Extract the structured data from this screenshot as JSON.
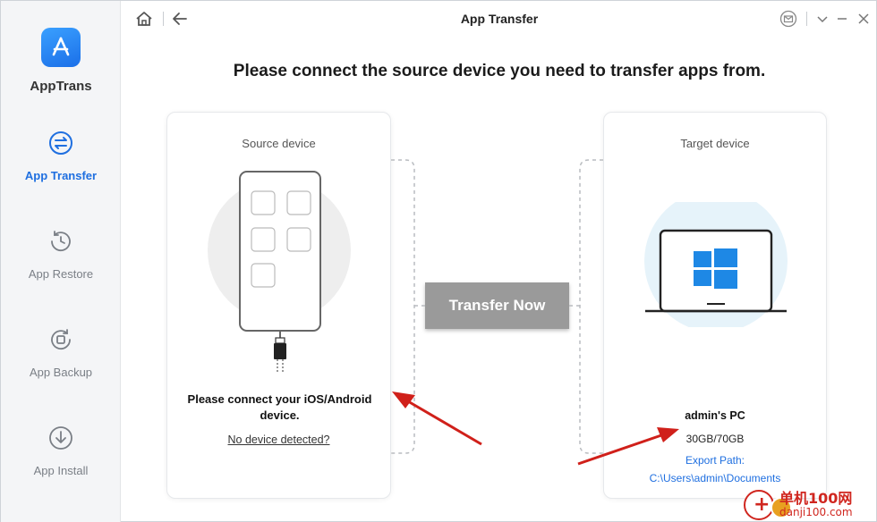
{
  "app": {
    "name": "AppTrans",
    "logo_icon": "app-store-a-icon"
  },
  "titlebar": {
    "title": "App Transfer"
  },
  "sidebar": {
    "items": [
      {
        "label": "App Transfer",
        "icon": "transfer-arrows-icon",
        "active": true
      },
      {
        "label": "App Restore",
        "icon": "clock-restore-icon",
        "active": false
      },
      {
        "label": "App Backup",
        "icon": "backup-icon",
        "active": false
      },
      {
        "label": "App Install",
        "icon": "download-icon",
        "active": false
      }
    ]
  },
  "main": {
    "headline": "Please connect the source device you need to transfer apps from.",
    "source": {
      "title": "Source device",
      "message": "Please connect your iOS/Android device.",
      "link": "No device detected?"
    },
    "target": {
      "title": "Target device",
      "name": "admin's PC",
      "storage": "30GB/70GB",
      "export_label": "Export Path:",
      "export_path": "C:\\Users\\admin\\Documents"
    },
    "transfer_button": "Transfer Now"
  },
  "watermark": {
    "text": "单机100网",
    "url": "danji100.com"
  },
  "colors": {
    "accent": "#1f6fe0",
    "button_gray": "#9a9a9a",
    "annotation_red": "#d0201a"
  }
}
